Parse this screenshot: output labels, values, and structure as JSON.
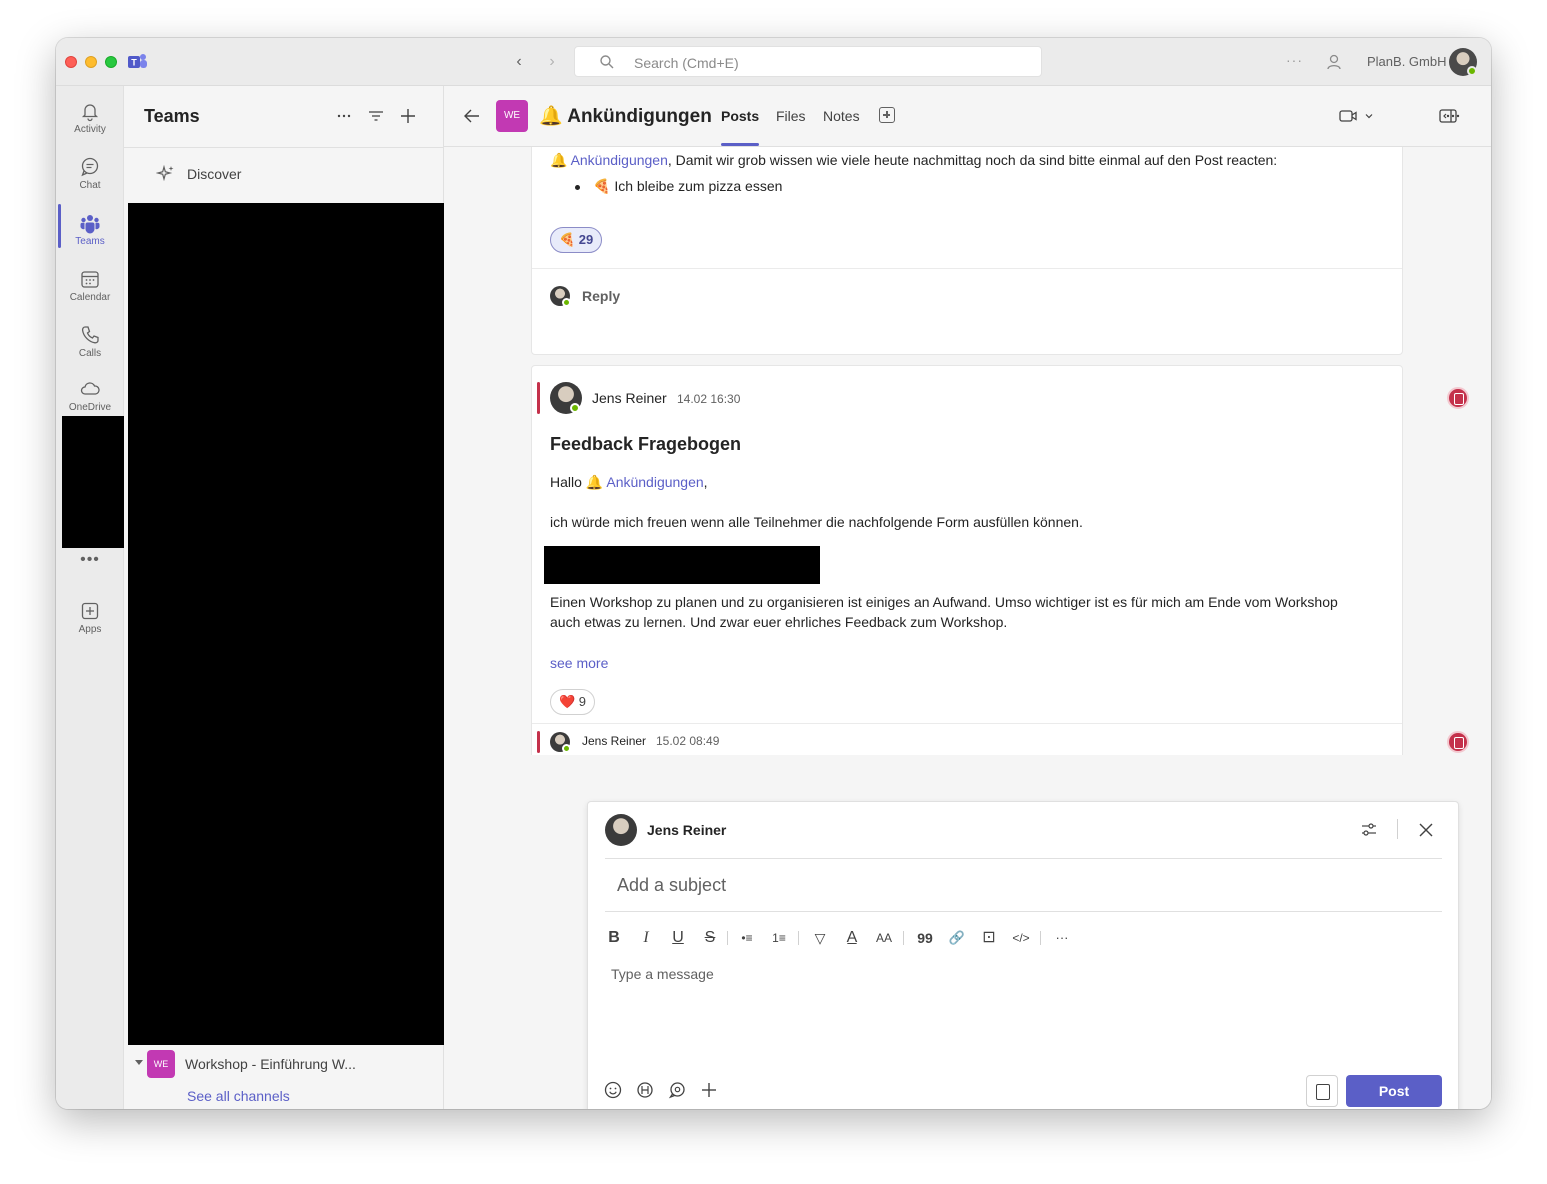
{
  "titlebar": {
    "search_placeholder": "Search (Cmd+E)",
    "more": "···",
    "org_name": "PlanB. GmbH"
  },
  "rail": {
    "items": [
      {
        "label": "Activity",
        "icon": "bell-icon"
      },
      {
        "label": "Chat",
        "icon": "chat-icon"
      },
      {
        "label": "Teams",
        "icon": "teams-icon",
        "active": true
      },
      {
        "label": "Calendar",
        "icon": "calendar-icon"
      },
      {
        "label": "Calls",
        "icon": "phone-icon"
      },
      {
        "label": "OneDrive",
        "icon": "cloud-icon"
      }
    ],
    "more": "•••",
    "apps_label": "Apps",
    "accent": "#5b5fc7"
  },
  "teams_panel": {
    "title": "Teams",
    "discover_label": "Discover",
    "team": {
      "avatar": "WE",
      "name": "Workshop - Einführung W..."
    },
    "see_all": "See all channels"
  },
  "channel": {
    "avatar": "WE",
    "title": "🔔 Ankündigungen",
    "tabs": [
      {
        "label": "Posts",
        "active": true
      },
      {
        "label": "Files"
      },
      {
        "label": "Notes"
      }
    ]
  },
  "post1": {
    "mention_emoji": "🔔",
    "mention": "Ankündigungen",
    "text": ", Damit wir grob wissen wie viele heute nachmittag noch da sind bitte einmal auf den Post reacten:",
    "bullet": "🍕 Ich bleibe zum pizza essen",
    "reaction": "🍕 29",
    "reply": "Reply"
  },
  "post2": {
    "author": "Jens Reiner",
    "time": "14.02 16:30",
    "subject": "Feedback Fragebogen",
    "greeting_prefix": "Hallo ",
    "greeting_emoji": "🔔",
    "mention": "Ankündigungen",
    "greeting_suffix": ",",
    "line1": "ich würde mich freuen wenn alle Teilnehmer die nachfolgende Form ausfüllen können.",
    "line2": "Einen Workshop zu planen und zu organisieren ist einiges an Aufwand. Umso wichtiger ist es für mich am Ende vom Workshop",
    "line3": "auch etwas zu lernen. Und zwar euer ehrliches Feedback zum Workshop.",
    "see_more": "see more",
    "reaction": "❤️ 9"
  },
  "post3": {
    "author": "Jens Reiner",
    "time": "15.02 08:49"
  },
  "compose": {
    "author": "Jens Reiner",
    "subject_placeholder": "Add a subject",
    "message_placeholder": "Type a message",
    "post_label": "Post",
    "format_tools": [
      "B",
      "I",
      "U",
      "S",
      "•≡",
      "1≡",
      "▽",
      "A̲",
      "AA",
      "99",
      "🔗",
      "⊡",
      "</>",
      "···"
    ]
  }
}
